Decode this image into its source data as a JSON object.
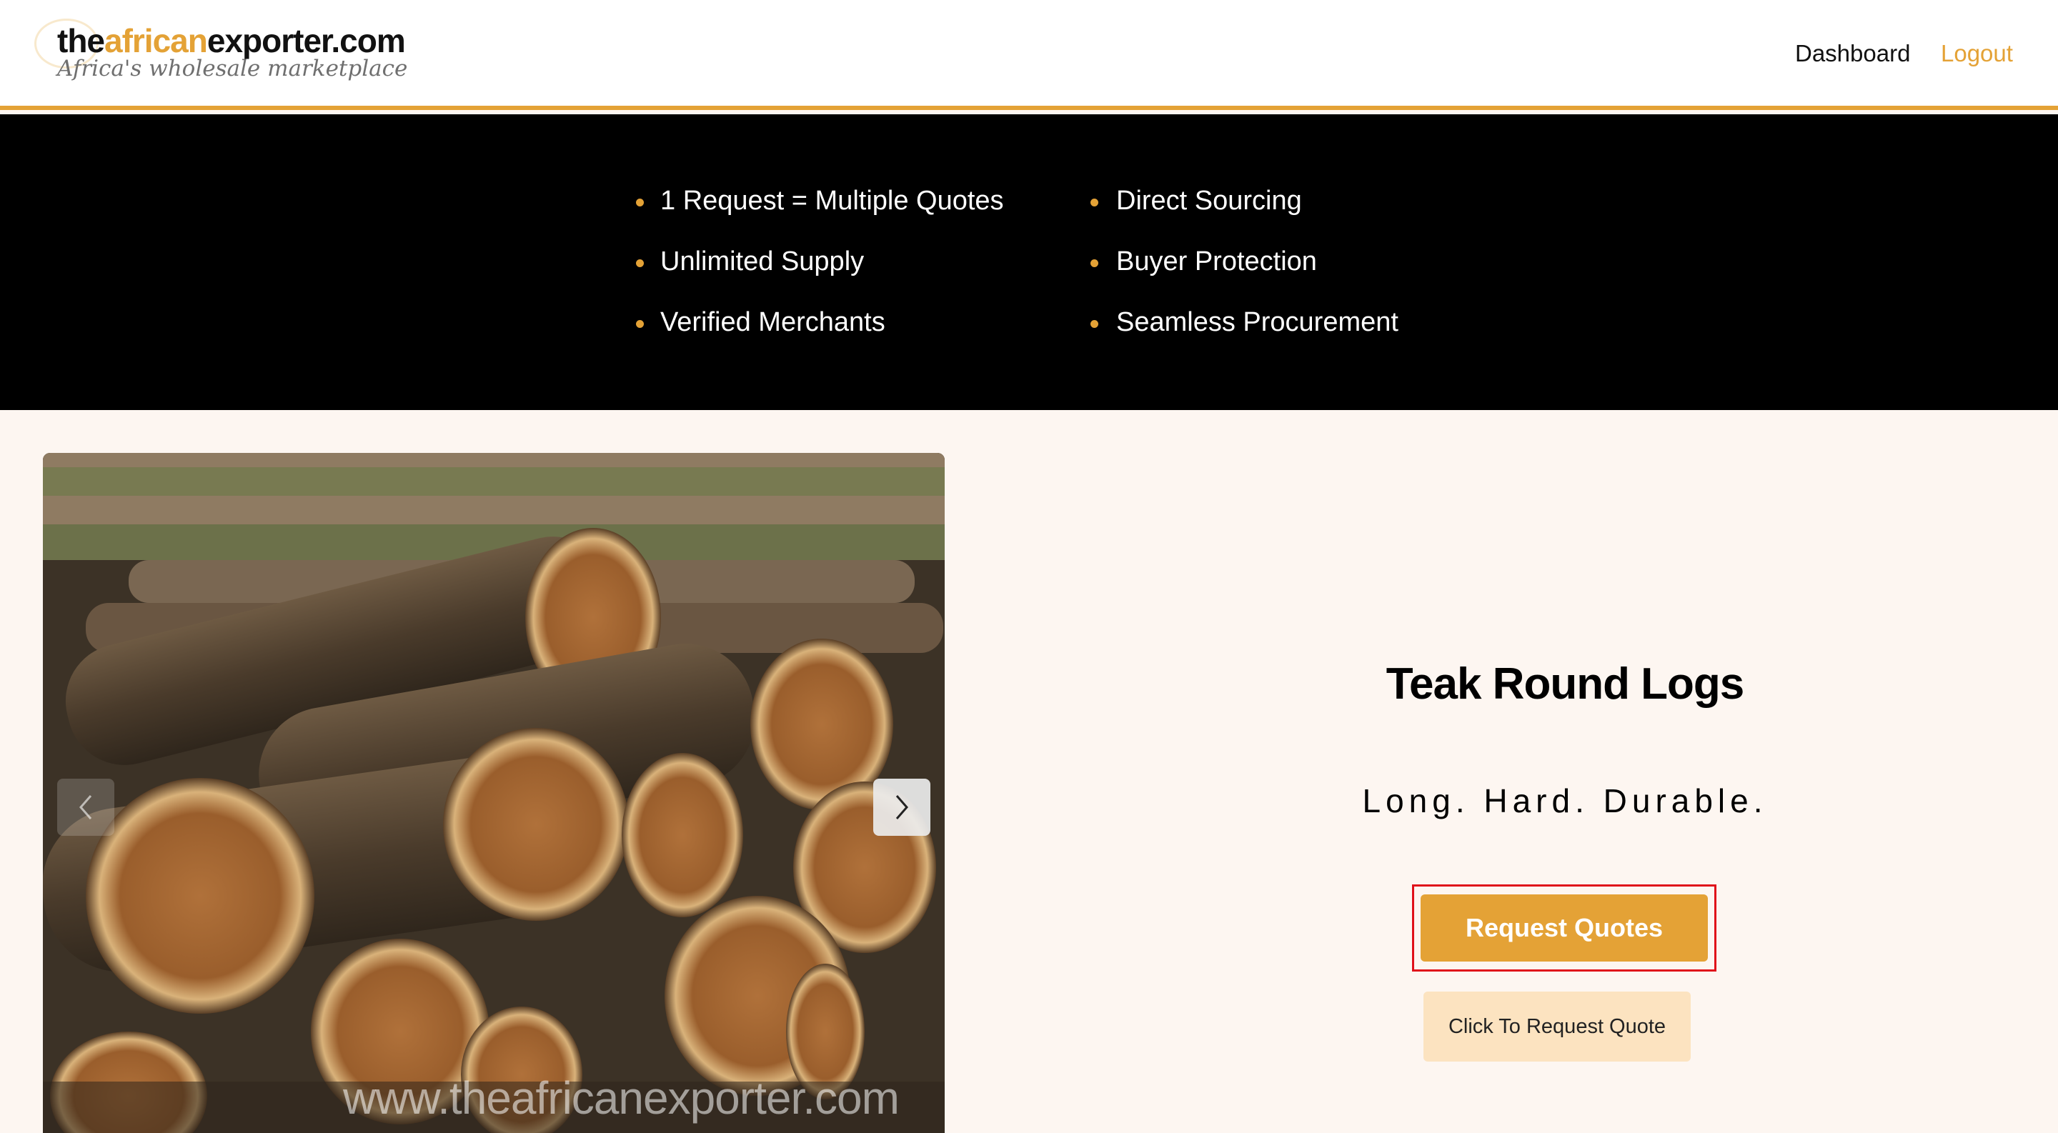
{
  "header": {
    "logo": {
      "name_part1": "the",
      "name_part2": "african",
      "name_part3": "exporter.com",
      "tagline": "Africa's wholesale marketplace"
    },
    "nav": {
      "dashboard": "Dashboard",
      "logout": "Logout"
    }
  },
  "features": {
    "left": [
      "1 Request = Multiple Quotes",
      "Unlimited Supply",
      "Verified Merchants"
    ],
    "right": [
      "Direct Sourcing",
      "Buyer Protection",
      "Seamless Procurement"
    ]
  },
  "carousel": {
    "watermark": "www.theafricanexporter.com",
    "prev_icon": "chevron-left-icon",
    "next_icon": "chevron-right-icon"
  },
  "product": {
    "title": "Teak Round Logs",
    "tagline": "Long. Hard. Durable.",
    "request_quotes_label": "Request Quotes",
    "click_to_request_label": "Click To Request Quote"
  },
  "colors": {
    "accent": "#e4a236",
    "band": "#000000",
    "page_bg": "#fdf6f1",
    "secondary_button": "#fce3c0",
    "highlight_outline": "#e0101a"
  }
}
